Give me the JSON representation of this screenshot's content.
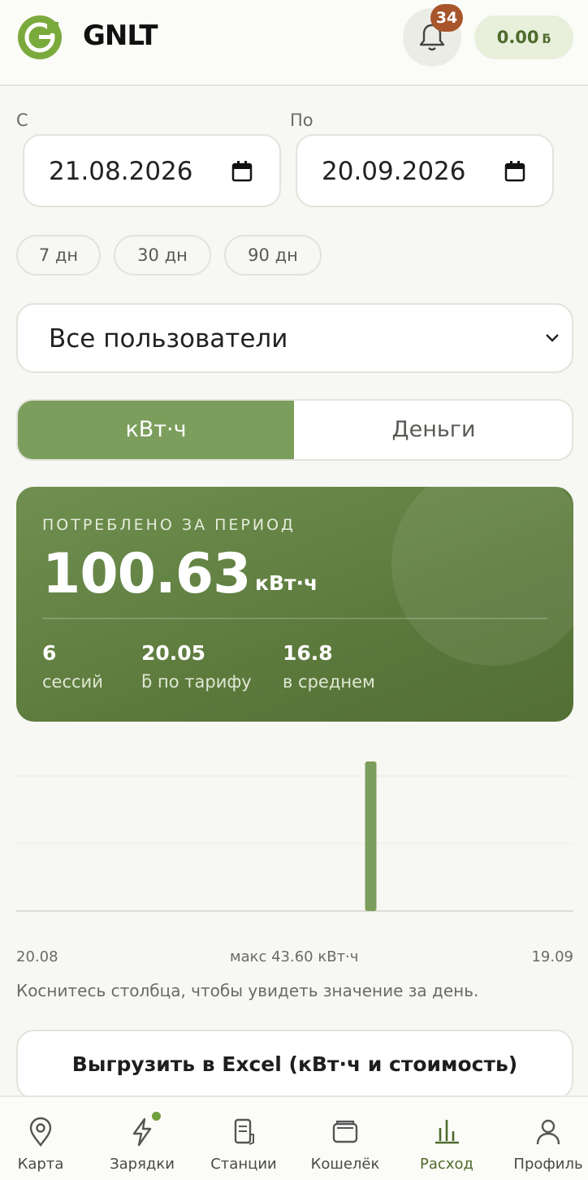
{
  "header": {
    "brand": "GNLT",
    "notification_count": "34",
    "balance_amount": "0.00",
    "balance_currency": "ƃ"
  },
  "filters": {
    "from_label": "С",
    "from_date": "21.08.2026",
    "to_label": "По",
    "to_date": "20.09.2026",
    "quick_ranges": [
      "7 дн",
      "30 дн",
      "90 дн"
    ],
    "user_select_value": "Все пользователи"
  },
  "units_toggle": {
    "options": [
      "кВт·ч",
      "Деньги"
    ],
    "active": "кВт·ч"
  },
  "summary": {
    "title": "ПОТРЕБЛЕНО ЗА ПЕРИОД",
    "total": "100.63",
    "unit": "кВт·ч",
    "stats": [
      {
        "value": "6",
        "label": "сессий"
      },
      {
        "value": "20.05",
        "label": "ƃ по тарифу"
      },
      {
        "value": "16.8",
        "label": "в среднем"
      }
    ]
  },
  "chart_data": {
    "type": "bar",
    "x_start_label": "20.08",
    "x_end_label": "19.09",
    "max_label": "макс 43.60 кВт·ч",
    "ylim": [
      0,
      43.6
    ],
    "grid": true,
    "values": [
      0,
      0,
      0,
      0,
      0,
      0,
      0,
      0,
      0,
      0,
      0,
      0,
      0,
      0,
      0,
      0,
      0,
      0,
      0,
      43.6,
      0,
      0,
      0,
      0,
      0,
      0,
      0,
      0,
      0,
      0,
      0
    ]
  },
  "hint": "Коснитесь столбца, чтобы увидеть значение за день.",
  "export_label": "Выгрузить в Excel (кВт·ч и стоимость)",
  "colors": {
    "accent": "#7c9e5c",
    "card": "#5c7a3c",
    "badge": "#a8552b",
    "bar": "#7c9e5c"
  },
  "tabs": [
    {
      "label": "Карта",
      "icon": "map-pin-icon"
    },
    {
      "label": "Зарядки",
      "icon": "lightning-icon"
    },
    {
      "label": "Станции",
      "icon": "document-icon"
    },
    {
      "label": "Кошелёк",
      "icon": "wallet-icon"
    },
    {
      "label": "Расход",
      "icon": "bar-chart-icon"
    },
    {
      "label": "Профиль",
      "icon": "user-icon"
    }
  ],
  "active_tab": "Расход"
}
